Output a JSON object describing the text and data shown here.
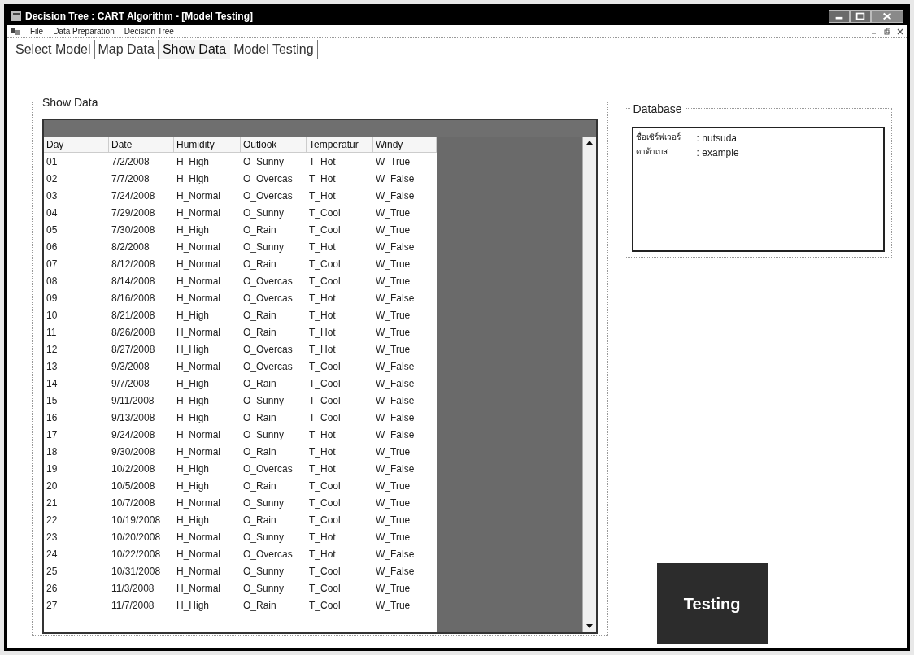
{
  "window": {
    "title": "Decision Tree : CART Algorithm - [Model Testing]"
  },
  "menu": [
    "File",
    "Data Preparation",
    "Decision Tree"
  ],
  "tabs": [
    {
      "label": "Select Model",
      "selected": false
    },
    {
      "label": "Map Data",
      "selected": false
    },
    {
      "label": "Show Data",
      "selected": true
    },
    {
      "label": "Model Testing",
      "selected": false
    }
  ],
  "show_data": {
    "title": "Show Data",
    "columns": [
      "Day",
      "Date",
      "Humidity",
      "Outlook",
      "Temperatur",
      "Windy"
    ],
    "rows": [
      [
        "01",
        "7/2/2008",
        "H_High",
        "O_Sunny",
        "T_Hot",
        "W_True"
      ],
      [
        "02",
        "7/7/2008",
        "H_High",
        "O_Overcas",
        "T_Hot",
        "W_False"
      ],
      [
        "03",
        "7/24/2008",
        "H_Normal",
        "O_Overcas",
        "T_Hot",
        "W_False"
      ],
      [
        "04",
        "7/29/2008",
        "H_Normal",
        "O_Sunny",
        "T_Cool",
        "W_True"
      ],
      [
        "05",
        "7/30/2008",
        "H_High",
        "O_Rain",
        "T_Cool",
        "W_True"
      ],
      [
        "06",
        "8/2/2008",
        "H_Normal",
        "O_Sunny",
        "T_Hot",
        "W_False"
      ],
      [
        "07",
        "8/12/2008",
        "H_Normal",
        "O_Rain",
        "T_Cool",
        "W_True"
      ],
      [
        "08",
        "8/14/2008",
        "H_Normal",
        "O_Overcas",
        "T_Cool",
        "W_True"
      ],
      [
        "09",
        "8/16/2008",
        "H_Normal",
        "O_Overcas",
        "T_Hot",
        "W_False"
      ],
      [
        "10",
        "8/21/2008",
        "H_High",
        "O_Rain",
        "T_Hot",
        "W_True"
      ],
      [
        "11",
        "8/26/2008",
        "H_Normal",
        "O_Rain",
        "T_Hot",
        "W_True"
      ],
      [
        "12",
        "8/27/2008",
        "H_High",
        "O_Overcas",
        "T_Hot",
        "W_True"
      ],
      [
        "13",
        "9/3/2008",
        "H_Normal",
        "O_Overcas",
        "T_Cool",
        "W_False"
      ],
      [
        "14",
        "9/7/2008",
        "H_High",
        "O_Rain",
        "T_Cool",
        "W_False"
      ],
      [
        "15",
        "9/11/2008",
        "H_High",
        "O_Sunny",
        "T_Cool",
        "W_False"
      ],
      [
        "16",
        "9/13/2008",
        "H_High",
        "O_Rain",
        "T_Cool",
        "W_False"
      ],
      [
        "17",
        "9/24/2008",
        "H_Normal",
        "O_Sunny",
        "T_Hot",
        "W_False"
      ],
      [
        "18",
        "9/30/2008",
        "H_Normal",
        "O_Rain",
        "T_Hot",
        "W_True"
      ],
      [
        "19",
        "10/2/2008",
        "H_High",
        "O_Overcas",
        "T_Hot",
        "W_False"
      ],
      [
        "20",
        "10/5/2008",
        "H_High",
        "O_Rain",
        "T_Cool",
        "W_True"
      ],
      [
        "21",
        "10/7/2008",
        "H_Normal",
        "O_Sunny",
        "T_Cool",
        "W_True"
      ],
      [
        "22",
        "10/19/2008",
        "H_High",
        "O_Rain",
        "T_Cool",
        "W_True"
      ],
      [
        "23",
        "10/20/2008",
        "H_Normal",
        "O_Sunny",
        "T_Hot",
        "W_True"
      ],
      [
        "24",
        "10/22/2008",
        "H_Normal",
        "O_Overcas",
        "T_Hot",
        "W_False"
      ],
      [
        "25",
        "10/31/2008",
        "H_Normal",
        "O_Sunny",
        "T_Cool",
        "W_False"
      ],
      [
        "26",
        "11/3/2008",
        "H_Normal",
        "O_Sunny",
        "T_Cool",
        "W_True"
      ],
      [
        "27",
        "11/7/2008",
        "H_High",
        "O_Rain",
        "T_Cool",
        "W_True"
      ]
    ]
  },
  "database": {
    "title": "Database",
    "fields": [
      {
        "label": "ชื่อเซิร์ฟเวอร์",
        "value": ": nutsuda"
      },
      {
        "label": "ดาต้าเบส",
        "value": ": example"
      }
    ]
  },
  "testing_button": "Testing"
}
